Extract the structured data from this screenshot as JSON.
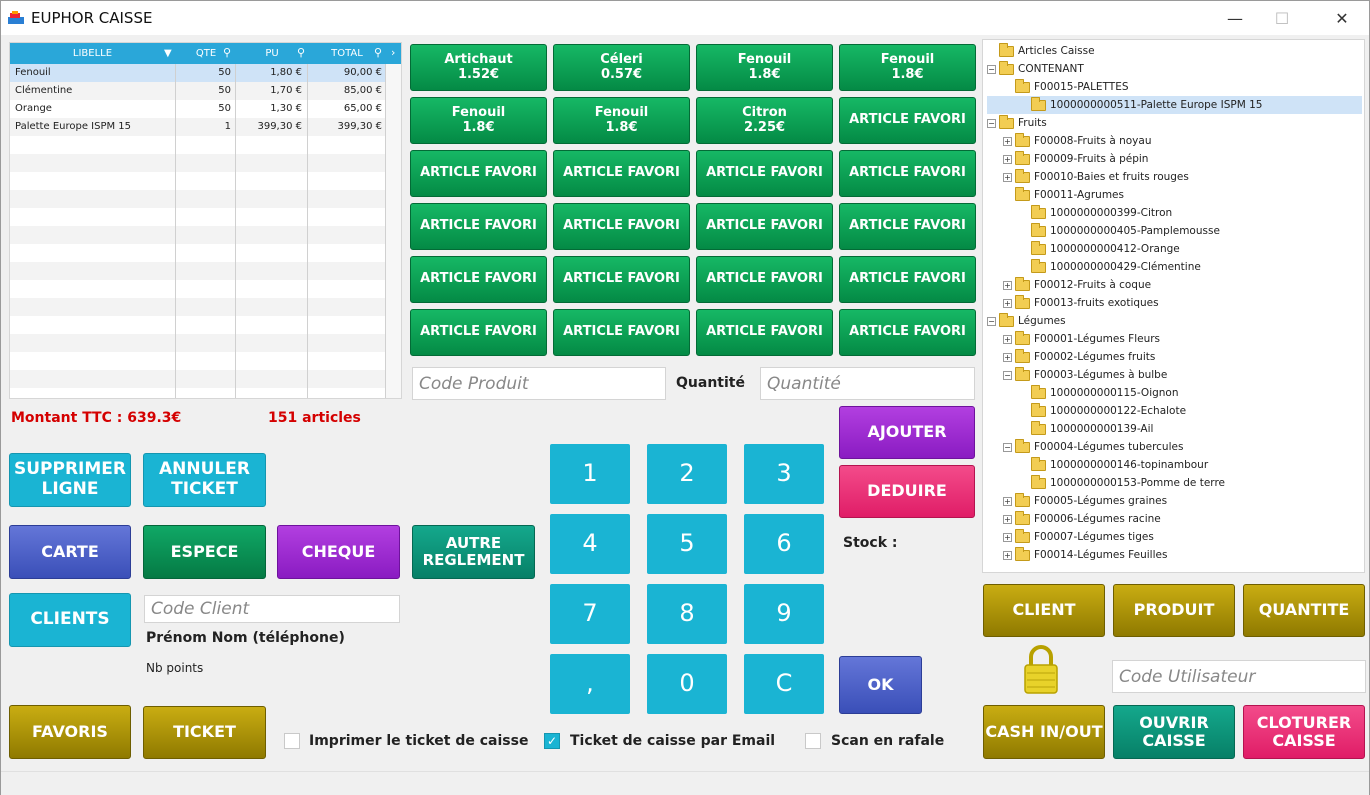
{
  "window": {
    "title": "EUPHOR CAISSE",
    "min": "—",
    "max": "☐",
    "close": "✕"
  },
  "table": {
    "headers": [
      "LIBELLE",
      "QTE",
      "PU",
      "TOTAL"
    ],
    "rows": [
      [
        "Fenouil",
        "50",
        "1,80 €",
        "90,00 €"
      ],
      [
        "Clémentine",
        "50",
        "1,70 €",
        "85,00 €"
      ],
      [
        "Orange",
        "50",
        "1,30 €",
        "65,00 €"
      ],
      [
        "Palette Europe ISPM 15",
        "1",
        "399,30 €",
        "399,30 €"
      ]
    ]
  },
  "summary": {
    "montant": "Montant TTC : 639.3€",
    "articles": "151 articles"
  },
  "favorites": [
    {
      "name": "Artichaut",
      "price": "1.52€"
    },
    {
      "name": "Céleri",
      "price": "0.57€"
    },
    {
      "name": "Fenouil",
      "price": "1.8€"
    },
    {
      "name": "Fenouil",
      "price": "1.8€"
    },
    {
      "name": "Fenouil",
      "price": "1.8€"
    },
    {
      "name": "Fenouil",
      "price": "1.8€"
    },
    {
      "name": "Citron",
      "price": "2.25€"
    },
    {
      "name": "ARTICLE FAVORI",
      "price": ""
    },
    {
      "name": "ARTICLE FAVORI",
      "price": ""
    },
    {
      "name": "ARTICLE FAVORI",
      "price": ""
    },
    {
      "name": "ARTICLE FAVORI",
      "price": ""
    },
    {
      "name": "ARTICLE FAVORI",
      "price": ""
    },
    {
      "name": "ARTICLE FAVORI",
      "price": ""
    },
    {
      "name": "ARTICLE FAVORI",
      "price": ""
    },
    {
      "name": "ARTICLE FAVORI",
      "price": ""
    },
    {
      "name": "ARTICLE FAVORI",
      "price": ""
    },
    {
      "name": "ARTICLE FAVORI",
      "price": ""
    },
    {
      "name": "ARTICLE FAVORI",
      "price": ""
    },
    {
      "name": "ARTICLE FAVORI",
      "price": ""
    },
    {
      "name": "ARTICLE FAVORI",
      "price": ""
    },
    {
      "name": "ARTICLE FAVORI",
      "price": ""
    },
    {
      "name": "ARTICLE FAVORI",
      "price": ""
    },
    {
      "name": "ARTICLE FAVORI",
      "price": ""
    },
    {
      "name": "ARTICLE FAVORI",
      "price": ""
    }
  ],
  "product": {
    "code_placeholder": "Code Produit",
    "qty_label": "Quantité",
    "qty_placeholder": "Quantité",
    "stock_label": "Stock :"
  },
  "actions": {
    "ajouter": "AJOUTER",
    "deduire": "DEDUIRE",
    "ok": "OK",
    "supprimer": "SUPPRIMER LIGNE",
    "annuler": "ANNULER TICKET",
    "carte": "CARTE",
    "espece": "ESPECE",
    "cheque": "CHEQUE",
    "autre": "AUTRE REGLEMENT",
    "clients": "CLIENTS",
    "favoris": "FAVORIS",
    "ticket": "TICKET"
  },
  "keypad": [
    "1",
    "2",
    "3",
    "4",
    "5",
    "6",
    "7",
    "8",
    "9",
    ",",
    "0",
    "C"
  ],
  "client": {
    "code_placeholder": "Code Client",
    "name": "Prénom Nom (téléphone)",
    "points": "Nb points"
  },
  "options": {
    "print": "Imprimer le ticket de caisse",
    "email": "Ticket de caisse par Email",
    "scan": "Scan en rafale",
    "email_checked": true
  },
  "tree": [
    {
      "l": 0,
      "e": "",
      "t": "Articles Caisse"
    },
    {
      "l": 0,
      "e": "−",
      "t": "CONTENANT"
    },
    {
      "l": 1,
      "e": "",
      "t": "F00015-PALETTES"
    },
    {
      "l": 2,
      "e": "",
      "t": "1000000000511-Palette Europe ISPM 15",
      "sel": true
    },
    {
      "l": 0,
      "e": "−",
      "t": "Fruits"
    },
    {
      "l": 1,
      "e": "+",
      "t": "F00008-Fruits à noyau"
    },
    {
      "l": 1,
      "e": "+",
      "t": "F00009-Fruits à pépin"
    },
    {
      "l": 1,
      "e": "+",
      "t": "F00010-Baies et fruits rouges"
    },
    {
      "l": 1,
      "e": "",
      "t": "F00011-Agrumes"
    },
    {
      "l": 2,
      "e": "",
      "t": "1000000000399-Citron"
    },
    {
      "l": 2,
      "e": "",
      "t": "1000000000405-Pamplemousse"
    },
    {
      "l": 2,
      "e": "",
      "t": "1000000000412-Orange"
    },
    {
      "l": 2,
      "e": "",
      "t": "1000000000429-Clémentine"
    },
    {
      "l": 1,
      "e": "+",
      "t": "F00012-Fruits à coque"
    },
    {
      "l": 1,
      "e": "+",
      "t": "F00013-fruits exotiques"
    },
    {
      "l": 0,
      "e": "−",
      "t": "Légumes"
    },
    {
      "l": 1,
      "e": "+",
      "t": "F00001-Légumes Fleurs"
    },
    {
      "l": 1,
      "e": "+",
      "t": "F00002-Légumes fruits"
    },
    {
      "l": 1,
      "e": "−",
      "t": "F00003-Légumes à bulbe"
    },
    {
      "l": 2,
      "e": "",
      "t": "1000000000115-Oignon"
    },
    {
      "l": 2,
      "e": "",
      "t": "1000000000122-Echalote"
    },
    {
      "l": 2,
      "e": "",
      "t": "1000000000139-Ail"
    },
    {
      "l": 1,
      "e": "−",
      "t": "F00004-Légumes tubercules"
    },
    {
      "l": 2,
      "e": "",
      "t": "1000000000146-topinambour"
    },
    {
      "l": 2,
      "e": "",
      "t": "1000000000153-Pomme de terre"
    },
    {
      "l": 1,
      "e": "+",
      "t": "F00005-Légumes graines"
    },
    {
      "l": 1,
      "e": "+",
      "t": "F00006-Légumes racine"
    },
    {
      "l": 1,
      "e": "+",
      "t": "F00007-Légumes tiges"
    },
    {
      "l": 1,
      "e": "+",
      "t": "F00014-Légumes Feuilles"
    }
  ],
  "right": {
    "client": "CLIENT",
    "produit": "PRODUIT",
    "quantite": "QUANTITE",
    "user_placeholder": "Code Utilisateur",
    "cash": "CASH IN/OUT",
    "ouvrir": "OUVRIR CAISSE",
    "cloturer": "CLOTURER CAISSE"
  }
}
